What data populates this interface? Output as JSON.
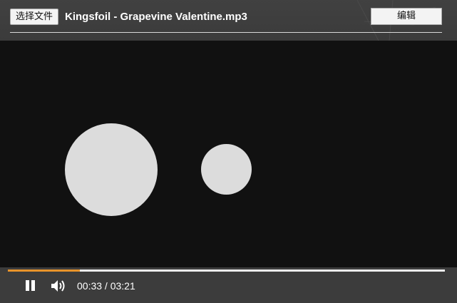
{
  "header": {
    "file_button_label": "选择文件",
    "file_name": "Kingsfoil - Grapevine Valentine.mp3",
    "edit_button_label": "编辑"
  },
  "player": {
    "progress_fraction": 0.164,
    "current_time": "00:33",
    "separator": "/",
    "duration": "03:21",
    "time_display": "00:33 / 03:21",
    "state": "playing"
  },
  "icons": {
    "pause": "pause-icon",
    "volume": "volume-icon"
  },
  "colors": {
    "header_bg": "#3f3f3f",
    "visual_bg": "#111111",
    "circle": "#dcdcdc",
    "progress_fill": "#e8932a",
    "progress_track": "#ececec"
  }
}
